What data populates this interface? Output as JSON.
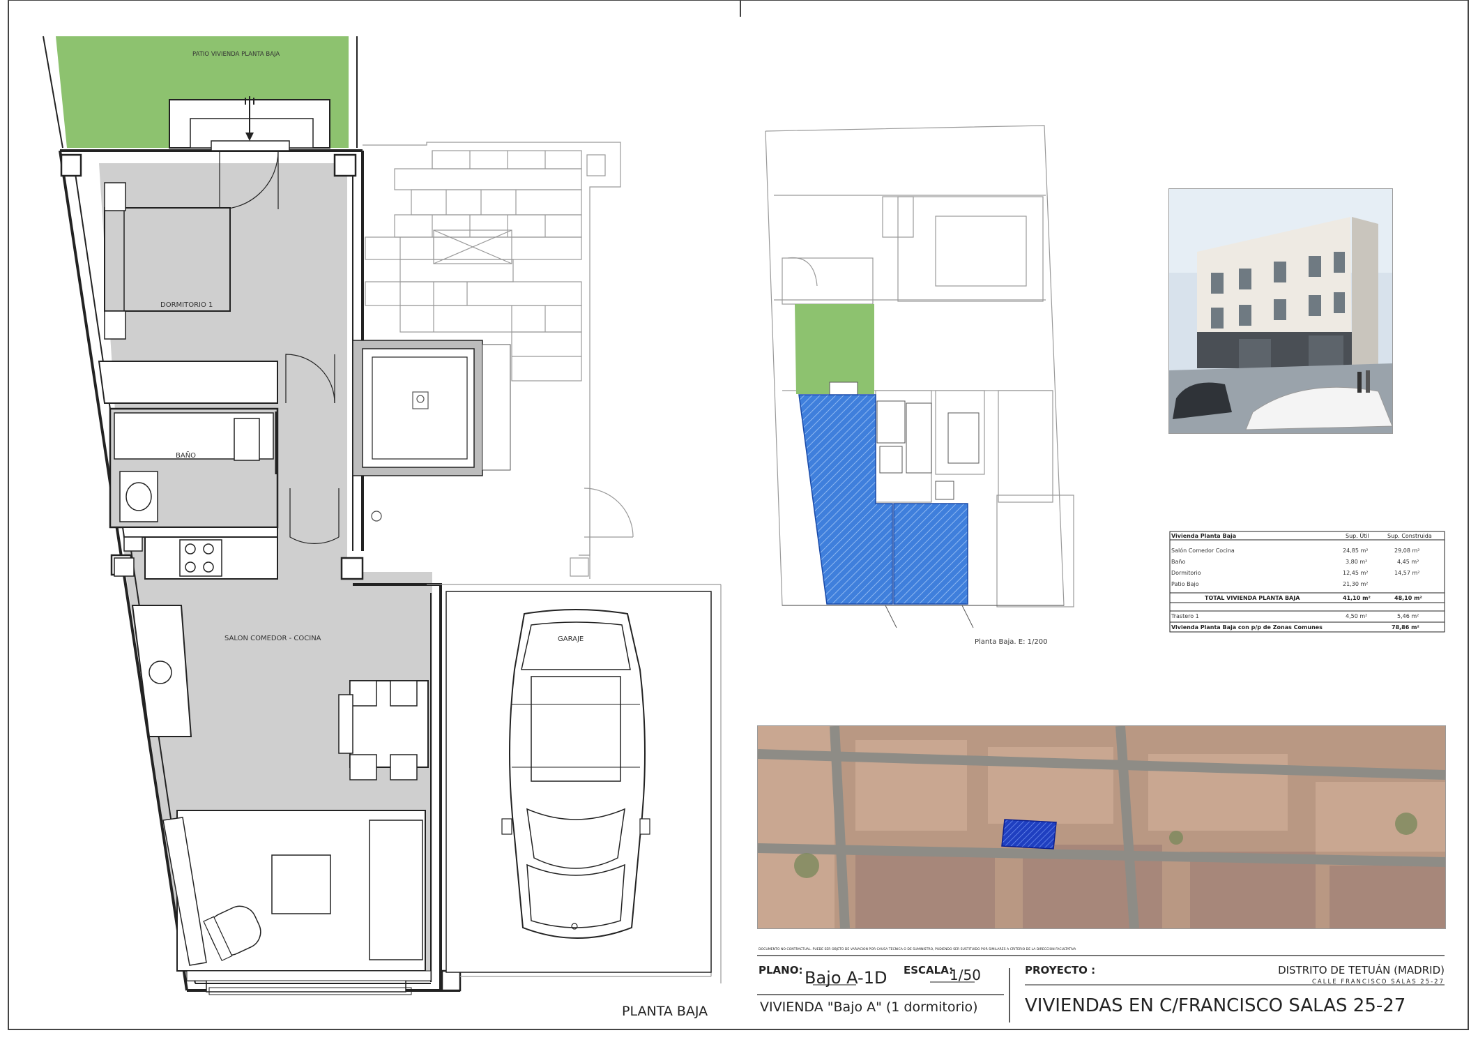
{
  "sheet": {
    "view_label": "PLANTA BAJA",
    "rooms": {
      "patio": "PATIO VIVIENDA PLANTA BAJA",
      "dormitorio": "DORMITORIO 1",
      "bano": "BAÑO",
      "salon": "SALON COMEDOR - COCINA",
      "garaje": "GARAJE"
    }
  },
  "site_plan": {
    "caption": "Planta Baja. E: 1/200"
  },
  "areas_table": {
    "headers": [
      "Vivienda Planta Baja",
      "Sup. Útil",
      "Sup. Construida"
    ],
    "rows": [
      [
        "Salón Comedor Cocina",
        "24,85 m²",
        "29,08 m²"
      ],
      [
        "Baño",
        "3,80 m²",
        "4,45 m²"
      ],
      [
        "Dormitorio",
        "12,45 m²",
        "14,57 m²"
      ],
      [
        "Patio Bajo",
        "21,30 m²",
        ""
      ]
    ],
    "total": [
      "TOTAL VIVIENDA PLANTA BAJA",
      "41,10 m²",
      "48,10 m²"
    ],
    "trastero": [
      "Trastero 1",
      "4,50 m²",
      "5,46 m²"
    ],
    "common": [
      "Vivienda Planta Baja con p/p de Zonas Comunes",
      "78,86 m²"
    ]
  },
  "title_block": {
    "disclaimer": "DOCUMENTO NO CONTRACTUAL. PUEDE SER OBJETO DE VARIACION POR CAUSA TECNICA O DE SUMINISTRO, PUDIENDO SER SUSTITUIDO POR SIMILARES A CRITERIO DE LA DIRECCION FACULTATIVA",
    "plano_label": "PLANO:",
    "plano_value": "Bajo A-1D",
    "escala_label": "ESCALA:",
    "escala_value": "1/50",
    "vivienda": "VIVIENDA \"Bajo A\" (1 dormitorio)",
    "proyecto_label": "PROYECTO :",
    "district": "DISTRITO DE TETUÁN (MADRID)",
    "street": "CALLE FRANCISCO SALAS 25-27",
    "project_name": "VIVIENDAS EN C/FRANCISCO SALAS 25-27"
  },
  "colors": {
    "patio_green": "#8dc26f",
    "floor_grey": "#cfcfcf",
    "highlight_blue": "#3a78d6",
    "line": "#222222"
  }
}
